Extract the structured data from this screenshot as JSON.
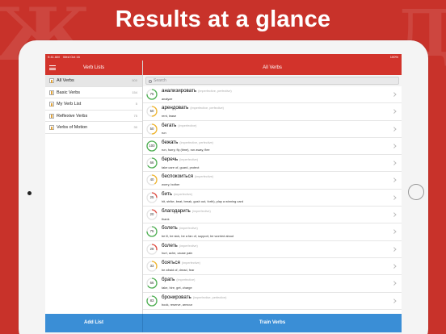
{
  "headline": "Results at a glance",
  "status_bar": {
    "time": "9:41 AM",
    "date": "Wed Oct 16",
    "battery": "100%"
  },
  "sidebar": {
    "title": "Verb Lists",
    "items": [
      {
        "label": "All Verbs",
        "count": "500"
      },
      {
        "label": "Basic Verbs",
        "count": "154"
      },
      {
        "label": "My Verb List",
        "count": "5"
      },
      {
        "label": "Reflexive Verbs",
        "count": "75"
      },
      {
        "label": "Verbs of Motion",
        "count": "30"
      }
    ],
    "add_button": "Add List"
  },
  "main": {
    "title": "All Verbs",
    "search_placeholder": "Search",
    "train_button": "Train Verbs",
    "verbs": [
      {
        "word": "анализировать",
        "aspect": "(imperfective, perfective)",
        "gloss": "analyze",
        "score": "75"
      },
      {
        "word": "арендовать",
        "aspect": "(imperfective, perfective)",
        "gloss": "rent, lease",
        "score": "50"
      },
      {
        "word": "бегать",
        "aspect": "(imperfective)",
        "gloss": "run",
        "score": "50"
      },
      {
        "word": "бежать",
        "aspect": "(imperfective, perfective)",
        "gloss": "run, hurry, fly (time), run away, flee",
        "score": "100"
      },
      {
        "word": "беречь",
        "aspect": "(imperfective)",
        "gloss": "take care of, guard, protect",
        "score": "66"
      },
      {
        "word": "беспокоиться",
        "aspect": "(imperfective)",
        "gloss": "worry, bother",
        "score": "40"
      },
      {
        "word": "бить",
        "aspect": "(imperfective)",
        "gloss": "hit, strike, beat, break, gush out, forth), play a winning card",
        "score": "25"
      },
      {
        "word": "благодарить",
        "aspect": "(imperfective)",
        "gloss": "thank",
        "score": "20"
      },
      {
        "word": "болеть",
        "aspect": "(imperfective)",
        "gloss": "be ill, be sick, be a fan of, support, be worried about",
        "score": "75"
      },
      {
        "word": "болеть",
        "aspect": "(imperfective)",
        "gloss": "hurt, ache, cause pain",
        "score": "28"
      },
      {
        "word": "бояться",
        "aspect": "(imperfective)",
        "gloss": "be afraid of, dread, fear",
        "score": "33"
      },
      {
        "word": "брать",
        "aspect": "(imperfective)",
        "gloss": "take, hire, get, charge",
        "score": "66"
      },
      {
        "word": "бронировать",
        "aspect": "(imperfective, perfective)",
        "gloss": "book, reserve, armour",
        "score": "83"
      }
    ]
  },
  "colors": {
    "brand_red": "#d2332b",
    "accent_blue": "#3a8ed6",
    "ring_green": "#4caf50",
    "ring_yellow": "#f0b429",
    "ring_red": "#e04a3f"
  },
  "score_values": [
    75,
    50,
    50,
    100,
    66,
    40,
    25,
    20,
    75,
    28,
    33,
    66,
    83
  ]
}
